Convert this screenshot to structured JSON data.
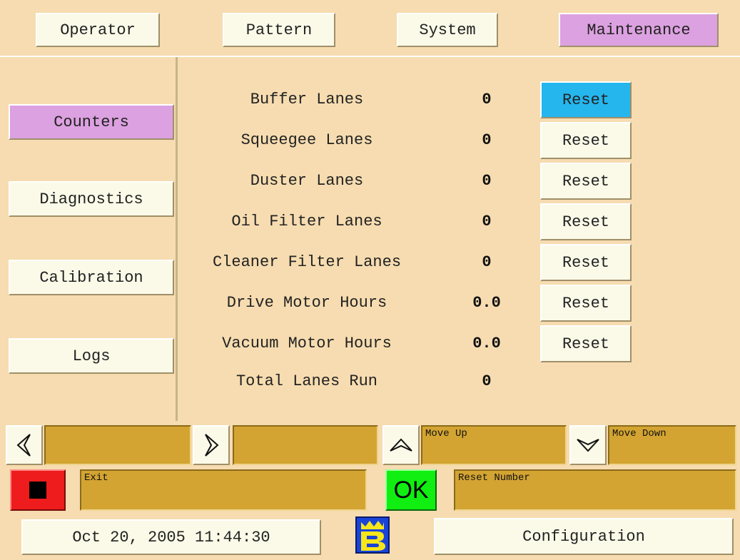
{
  "top_tabs": [
    "Operator",
    "Pattern",
    "System",
    "Maintenance"
  ],
  "side_tabs": [
    "Counters",
    "Diagnostics",
    "Calibration",
    "Logs"
  ],
  "counters": [
    {
      "label": "Buffer Lanes",
      "value": "0",
      "reset": "Reset"
    },
    {
      "label": "Squeegee Lanes",
      "value": "0",
      "reset": "Reset"
    },
    {
      "label": "Duster Lanes",
      "value": "0",
      "reset": "Reset"
    },
    {
      "label": "Oil Filter Lanes",
      "value": "0",
      "reset": "Reset"
    },
    {
      "label": "Cleaner Filter Lanes",
      "value": "0",
      "reset": "Reset"
    },
    {
      "label": "Drive Motor Hours",
      "value": "0.0",
      "reset": "Reset"
    },
    {
      "label": "Vacuum Motor Hours",
      "value": "0.0",
      "reset": "Reset"
    },
    {
      "label": "Total Lanes Run",
      "value": "0"
    }
  ],
  "nav": {
    "move_up": "Move Up",
    "move_down": "Move Down",
    "exit": "Exit",
    "ok": "OK",
    "reset_number": "Reset Number"
  },
  "footer": {
    "datetime": "Oct 20, 2005 11:44:30",
    "configuration": "Configuration"
  },
  "colors": {
    "background": "#f6dcb0",
    "active_tab": "#dca1e0",
    "selected_reset": "#25b6ee",
    "strip": "#d3a432",
    "stop": "#ee1c1c",
    "ok": "#11ee11",
    "logo_bg": "#1a44d8",
    "logo_fg": "#f6e61a"
  },
  "icons": {
    "left": "left-arrow-icon",
    "right": "right-arrow-icon",
    "up": "up-arrow-icon",
    "down": "down-arrow-icon",
    "stop": "stop-icon",
    "logo": "brand-logo-icon"
  }
}
